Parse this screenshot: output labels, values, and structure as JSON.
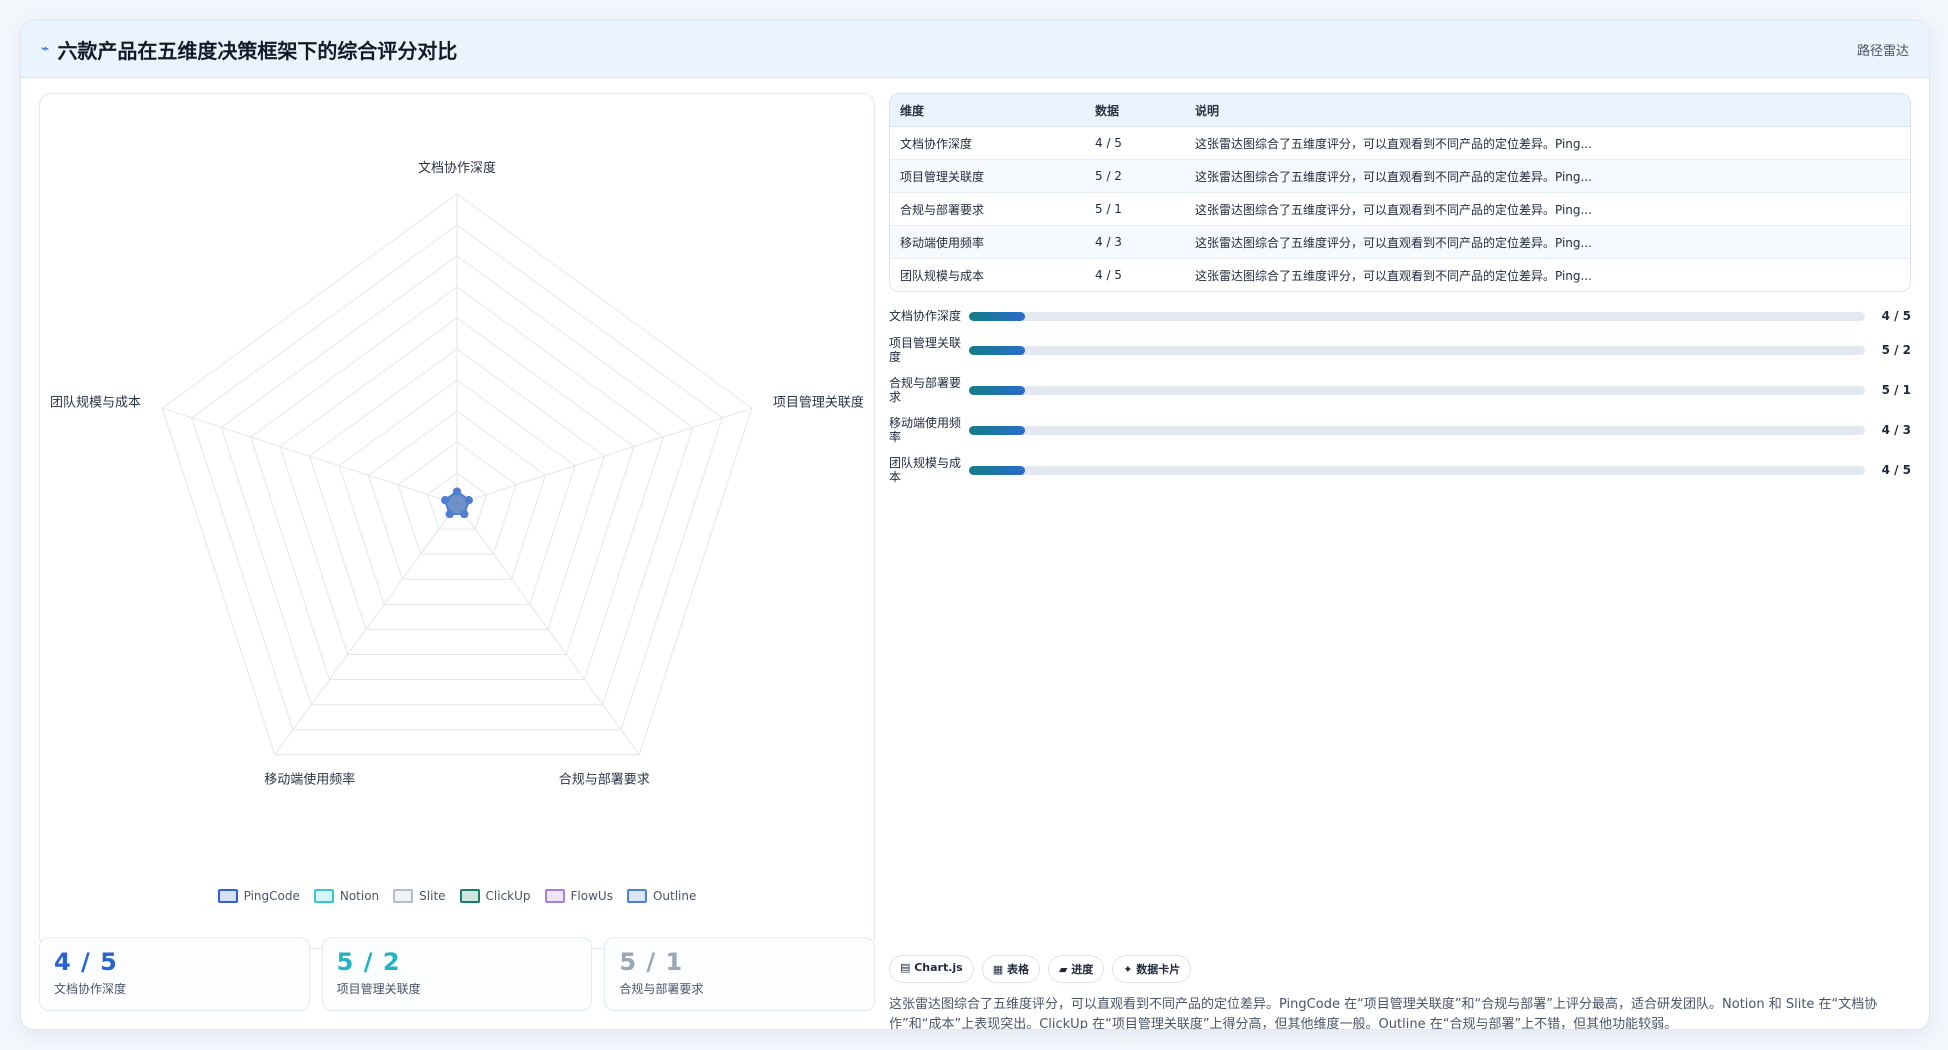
{
  "header": {
    "icon": "chart-icon",
    "title": "六款产品在五维度决策框架下的综合评分对比",
    "tag": "路径雷达"
  },
  "chart_data": {
    "type": "radar",
    "axes": [
      "文档协作深度",
      "项目管理关联度",
      "合规与部署要求",
      "移动端使用频率",
      "团队规模与成本"
    ],
    "rlim": [
      0,
      5
    ],
    "series": [
      {
        "name": "PingCode",
        "color": "#2f5fd0",
        "values": [
          0.2,
          0.2,
          0.2,
          0.2,
          0.2
        ]
      },
      {
        "name": "Notion",
        "color": "#38c6d4",
        "values": [
          0.2,
          0.2,
          0.2,
          0.2,
          0.2
        ]
      },
      {
        "name": "Slite",
        "color": "#b4bccb",
        "values": [
          0.2,
          0.2,
          0.2,
          0.2,
          0.2
        ]
      },
      {
        "name": "ClickUp",
        "color": "#1a7d6b",
        "values": [
          0.2,
          0.2,
          0.2,
          0.2,
          0.2
        ]
      },
      {
        "name": "FlowUs",
        "color": "#a57ee0",
        "values": [
          0.2,
          0.2,
          0.2,
          0.2,
          0.2
        ]
      },
      {
        "name": "Outline",
        "color": "#4d7fd4",
        "values": [
          0.2,
          0.2,
          0.2,
          0.2,
          0.2
        ]
      }
    ],
    "legend_position": "bottom",
    "grid": true
  },
  "kpis": [
    {
      "value": "4 / 5",
      "label": "文档协作深度",
      "color": "#2a63d0"
    },
    {
      "value": "5 / 2",
      "label": "项目管理关联度",
      "color": "#22b3c3"
    },
    {
      "value": "5 / 1",
      "label": "合规与部署要求",
      "color": "#9aa5b5"
    }
  ],
  "table": {
    "headers": [
      "维度",
      "数据",
      "说明"
    ],
    "rows": [
      {
        "dim": "文档协作深度",
        "data": "4 / 5",
        "desc": "这张雷达图综合了五维度评分，可以直观看到不同产品的定位差异。Ping..."
      },
      {
        "dim": "项目管理关联度",
        "data": "5 / 2",
        "desc": "这张雷达图综合了五维度评分，可以直观看到不同产品的定位差异。Ping..."
      },
      {
        "dim": "合规与部署要求",
        "data": "5 / 1",
        "desc": "这张雷达图综合了五维度评分，可以直观看到不同产品的定位差异。Ping..."
      },
      {
        "dim": "移动端使用频率",
        "data": "4 / 3",
        "desc": "这张雷达图综合了五维度评分，可以直观看到不同产品的定位差异。Ping..."
      },
      {
        "dim": "团队规模与成本",
        "data": "4 / 5",
        "desc": "这张雷达图综合了五维度评分，可以直观看到不同产品的定位差异。Ping..."
      }
    ]
  },
  "bars": [
    {
      "label": "文档协作深度",
      "value": "4 / 5",
      "fill": 0.063
    },
    {
      "label": "项目管理关联度",
      "value": "5 / 2",
      "fill": 0.063
    },
    {
      "label": "合规与部署要求",
      "value": "5 / 1",
      "fill": 0.063
    },
    {
      "label": "移动端使用频率",
      "value": "4 / 3",
      "fill": 0.063
    },
    {
      "label": "团队规模与成本",
      "value": "4 / 5",
      "fill": 0.063
    }
  ],
  "chips": [
    "▤ Chart.js",
    "▦ 表格",
    "▰ 进度",
    "✦ 数据卡片"
  ],
  "summary": "这张雷达图综合了五维度评分，可以直观看到不同产品的定位差异。PingCode 在“项目管理关联度”和“合规与部署”上评分最高，适合研发团队。Notion 和 Slite 在“文档协作”和“成本”上表现突出。ClickUp 在“项目管理关联度”上得分高，但其他维度一般。Outline 在“合规与部署”上不错，但其他功能较弱。"
}
